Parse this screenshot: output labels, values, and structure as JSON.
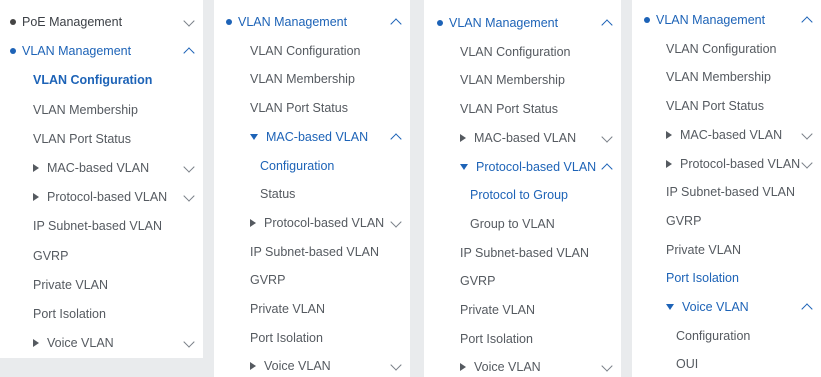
{
  "panels": [
    {
      "items": [
        {
          "label": "PoE Management",
          "level": 0,
          "marker": "dot",
          "chevron": "down"
        },
        {
          "label": "VLAN Management",
          "level": 0,
          "marker": "dot",
          "chevron": "up",
          "state": "open"
        },
        {
          "label": "VLAN Configuration",
          "level": 1,
          "state": "active"
        },
        {
          "label": "VLAN Membership",
          "level": 1
        },
        {
          "label": "VLAN Port Status",
          "level": 1
        },
        {
          "label": "MAC-based VLAN",
          "level": 1,
          "marker": "tri-right",
          "chevron": "down"
        },
        {
          "label": "Protocol-based VLAN",
          "level": 1,
          "marker": "tri-right",
          "chevron": "down"
        },
        {
          "label": "IP Subnet-based VLAN",
          "level": 1
        },
        {
          "label": "GVRP",
          "level": 1
        },
        {
          "label": "Private VLAN",
          "level": 1
        },
        {
          "label": "Port Isolation",
          "level": 1
        },
        {
          "label": "Voice VLAN",
          "level": 1,
          "marker": "tri-right",
          "chevron": "down"
        }
      ]
    },
    {
      "items": [
        {
          "label": "VLAN Management",
          "level": 0,
          "marker": "dot",
          "chevron": "up",
          "state": "open"
        },
        {
          "label": "VLAN Configuration",
          "level": 1
        },
        {
          "label": "VLAN Membership",
          "level": 1
        },
        {
          "label": "VLAN Port Status",
          "level": 1
        },
        {
          "label": "MAC-based VLAN",
          "level": 1,
          "marker": "tri-down",
          "chevron": "up",
          "state": "open"
        },
        {
          "label": "Configuration",
          "level": 2,
          "state": "selected"
        },
        {
          "label": "Status",
          "level": 2
        },
        {
          "label": "Protocol-based VLAN",
          "level": 1,
          "marker": "tri-right",
          "chevron": "down"
        },
        {
          "label": "IP Subnet-based VLAN",
          "level": 1
        },
        {
          "label": "GVRP",
          "level": 1
        },
        {
          "label": "Private VLAN",
          "level": 1
        },
        {
          "label": "Port Isolation",
          "level": 1
        },
        {
          "label": "Voice VLAN",
          "level": 1,
          "marker": "tri-right",
          "chevron": "down"
        }
      ]
    },
    {
      "items": [
        {
          "label": "VLAN Management",
          "level": 0,
          "marker": "dot",
          "chevron": "up",
          "state": "open"
        },
        {
          "label": "VLAN Configuration",
          "level": 1
        },
        {
          "label": "VLAN Membership",
          "level": 1
        },
        {
          "label": "VLAN Port Status",
          "level": 1
        },
        {
          "label": "MAC-based VLAN",
          "level": 1,
          "marker": "tri-right",
          "chevron": "down"
        },
        {
          "label": "Protocol-based VLAN",
          "level": 1,
          "marker": "tri-down",
          "chevron": "up",
          "state": "open"
        },
        {
          "label": "Protocol to Group",
          "level": 2,
          "state": "selected"
        },
        {
          "label": "Group to VLAN",
          "level": 2
        },
        {
          "label": "IP Subnet-based VLAN",
          "level": 1
        },
        {
          "label": "GVRP",
          "level": 1
        },
        {
          "label": "Private VLAN",
          "level": 1
        },
        {
          "label": "Port Isolation",
          "level": 1
        },
        {
          "label": "Voice VLAN",
          "level": 1,
          "marker": "tri-right",
          "chevron": "down"
        }
      ]
    },
    {
      "items": [
        {
          "label": "VLAN Management",
          "level": 0,
          "marker": "dot",
          "chevron": "up",
          "state": "open"
        },
        {
          "label": "VLAN Configuration",
          "level": 1
        },
        {
          "label": "VLAN Membership",
          "level": 1
        },
        {
          "label": "VLAN Port Status",
          "level": 1
        },
        {
          "label": "MAC-based VLAN",
          "level": 1,
          "marker": "tri-right",
          "chevron": "down"
        },
        {
          "label": "Protocol-based VLAN",
          "level": 1,
          "marker": "tri-right",
          "chevron": "down"
        },
        {
          "label": "IP Subnet-based VLAN",
          "level": 1
        },
        {
          "label": "GVRP",
          "level": 1
        },
        {
          "label": "Private VLAN",
          "level": 1
        },
        {
          "label": "Port Isolation",
          "level": 1,
          "state": "selected"
        },
        {
          "label": "Voice VLAN",
          "level": 1,
          "marker": "tri-down",
          "chevron": "up",
          "state": "open"
        },
        {
          "label": "Configuration",
          "level": 2
        },
        {
          "label": "OUI",
          "level": 2
        }
      ]
    }
  ],
  "colors": {
    "accent": "#1d63b7",
    "text": "#555a60",
    "background": "#ffffff"
  }
}
